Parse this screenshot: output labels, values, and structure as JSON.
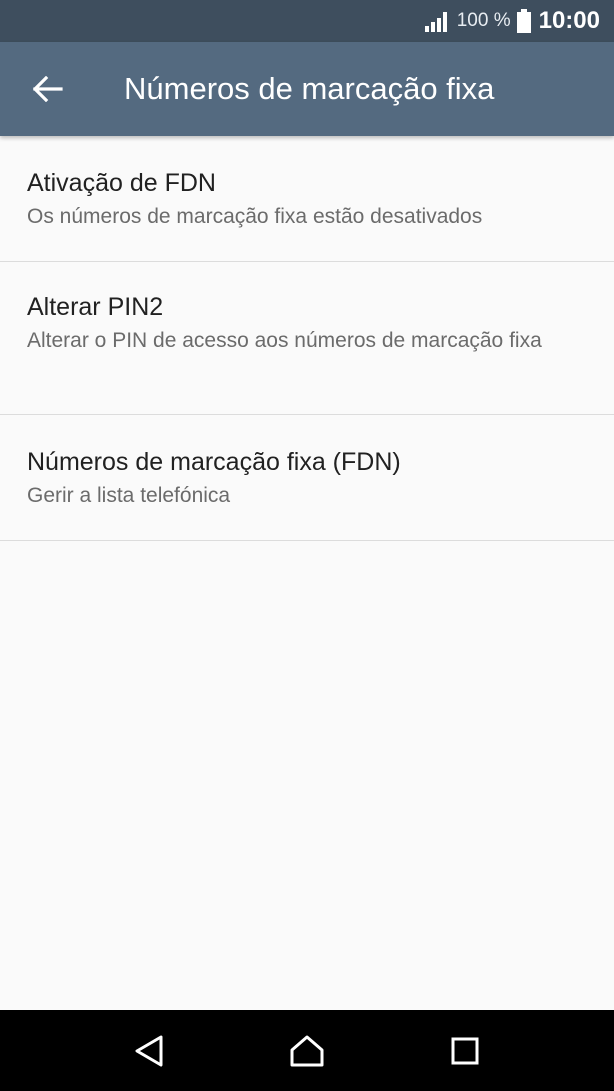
{
  "status_bar": {
    "battery_percent": "100 %",
    "time": "10:00",
    "icons": [
      "signal-icon",
      "battery-icon"
    ]
  },
  "app_bar": {
    "title": "Números de marcação fixa",
    "back_icon": "arrow-left-icon"
  },
  "items": [
    {
      "title": "Ativação de FDN",
      "summary": "Os números de marcação fixa estão desativados"
    },
    {
      "title": "Alterar PIN2",
      "summary": "Alterar o PIN de acesso aos números de marcação fixa"
    },
    {
      "title": "Números de marcação fixa (FDN)",
      "summary": "Gerir a lista telefónica"
    }
  ],
  "nav_bar": {
    "icons": [
      "back-triangle-icon",
      "home-icon",
      "recents-square-icon"
    ]
  },
  "colors": {
    "status_bar": "#3e4e5e",
    "app_bar": "#546a80",
    "background": "#fafafa",
    "divider": "#dcdcdc"
  }
}
